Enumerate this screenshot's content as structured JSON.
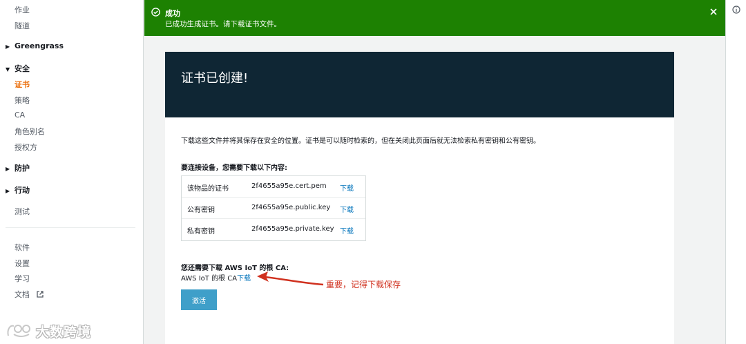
{
  "sidebar": {
    "items_top": [
      "作业",
      "隧道"
    ],
    "group_greengrass": "Greengrass",
    "group_security": "安全",
    "security_items": [
      "证书",
      "策略",
      "CA",
      "角色别名",
      "授权方"
    ],
    "group_defend": "防护",
    "group_act": "行动",
    "test": "测试",
    "bottom_items": [
      "软件",
      "设置",
      "学习",
      "文档"
    ]
  },
  "flash": {
    "title": "成功",
    "message": "已成功生成证书。请下载证书文件。"
  },
  "panel": {
    "title": "证书已创建!",
    "intro": "下载这些文件并将其保存在安全的位置。证书是可以随时检索的，但在关闭此页面后就无法检索私有密钥和公有密钥。",
    "need_label": "要连接设备，您需要下载以下内容:",
    "files": [
      {
        "label": "该物品的证书",
        "file": "2f4655a95e.cert.pem",
        "action": "下载"
      },
      {
        "label": "公有密钥",
        "file": "2f4655a95e.public.key",
        "action": "下载"
      },
      {
        "label": "私有密钥",
        "file": "2f4655a95e.private.key",
        "action": "下载"
      }
    ],
    "ca_label": "您还需要下载 AWS IoT 的根 CA:",
    "ca_text": "AWS IoT 的根 CA",
    "ca_link": "下载",
    "activate": "激活"
  },
  "annotation": {
    "note": "重要，记得下载保存"
  },
  "watermark": {
    "text": "大数跨境"
  },
  "colors": {
    "success": "#1d8102",
    "header": "#0f2634",
    "link": "#0073bb",
    "active_nav": "#ec7211",
    "button": "#3f9fc9",
    "annotation": "#d0311f"
  }
}
